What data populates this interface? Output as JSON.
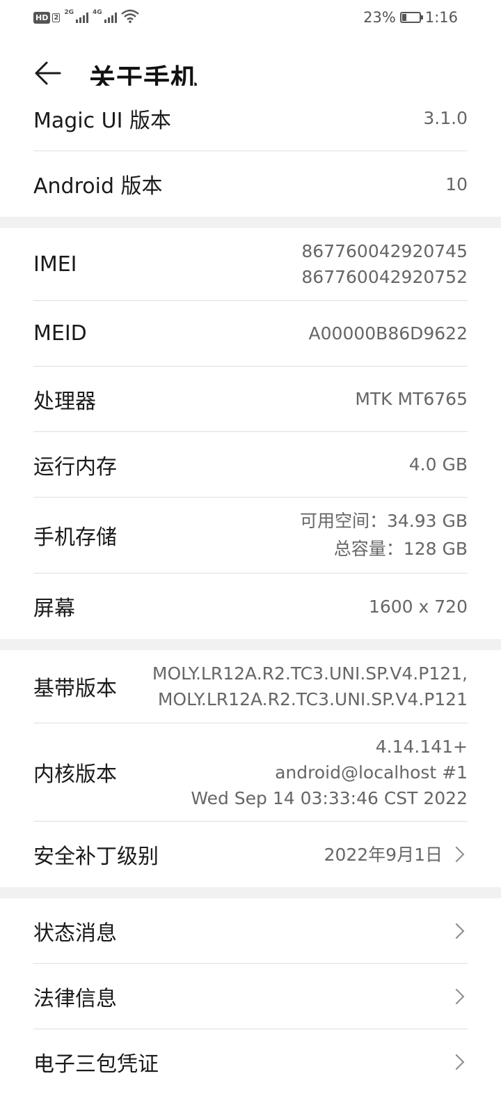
{
  "status_bar": {
    "hd_label": "HD",
    "sim_number": "2",
    "sim1_network": "2G",
    "sim2_network": "4G",
    "battery_percent": "23%",
    "battery_level": 0.23,
    "time": "1:16",
    "icons": [
      "hd-voice-icon",
      "signal-icon",
      "signal-icon",
      "wifi-icon",
      "battery-icon"
    ]
  },
  "header": {
    "back_icon": "arrow-left-icon",
    "title": "关于手机"
  },
  "groups": [
    {
      "rows": [
        {
          "label": "Magic UI 版本",
          "values": [
            "3.1.0"
          ]
        },
        {
          "label": "Android 版本",
          "values": [
            "10"
          ]
        }
      ]
    },
    {
      "rows": [
        {
          "label": "IMEI",
          "values": [
            "867760042920745",
            "867760042920752"
          ]
        },
        {
          "label": "MEID",
          "values": [
            "A00000B86D9622"
          ]
        },
        {
          "label": "处理器",
          "values": [
            "MTK MT6765"
          ]
        },
        {
          "label": "运行内存",
          "values": [
            "4.0 GB"
          ]
        },
        {
          "label": "手机存储",
          "values": [
            "可用空间：34.93  GB",
            "总容量：128  GB"
          ]
        },
        {
          "label": "屏幕",
          "values": [
            "1600 x 720"
          ]
        }
      ]
    },
    {
      "rows": [
        {
          "label": "基带版本",
          "values": [
            "MOLY.LR12A.R2.TC3.UNI.SP.V4.P121,",
            "MOLY.LR12A.R2.TC3.UNI.SP.V4.P121"
          ]
        },
        {
          "label": "内核版本",
          "values": [
            "4.14.141+",
            "android@localhost #1",
            "Wed Sep 14 03:33:46 CST 2022"
          ]
        },
        {
          "label": "安全补丁级别",
          "values": [
            "2022年9月1日"
          ],
          "arrow_icon": "chevron-right-icon"
        }
      ]
    },
    {
      "rows": [
        {
          "label": "状态消息",
          "arrow_icon": "chevron-right-icon"
        },
        {
          "label": "法律信息",
          "arrow_icon": "chevron-right-icon"
        },
        {
          "label": "电子三包凭证",
          "arrow_icon": "chevron-right-icon"
        }
      ]
    }
  ]
}
